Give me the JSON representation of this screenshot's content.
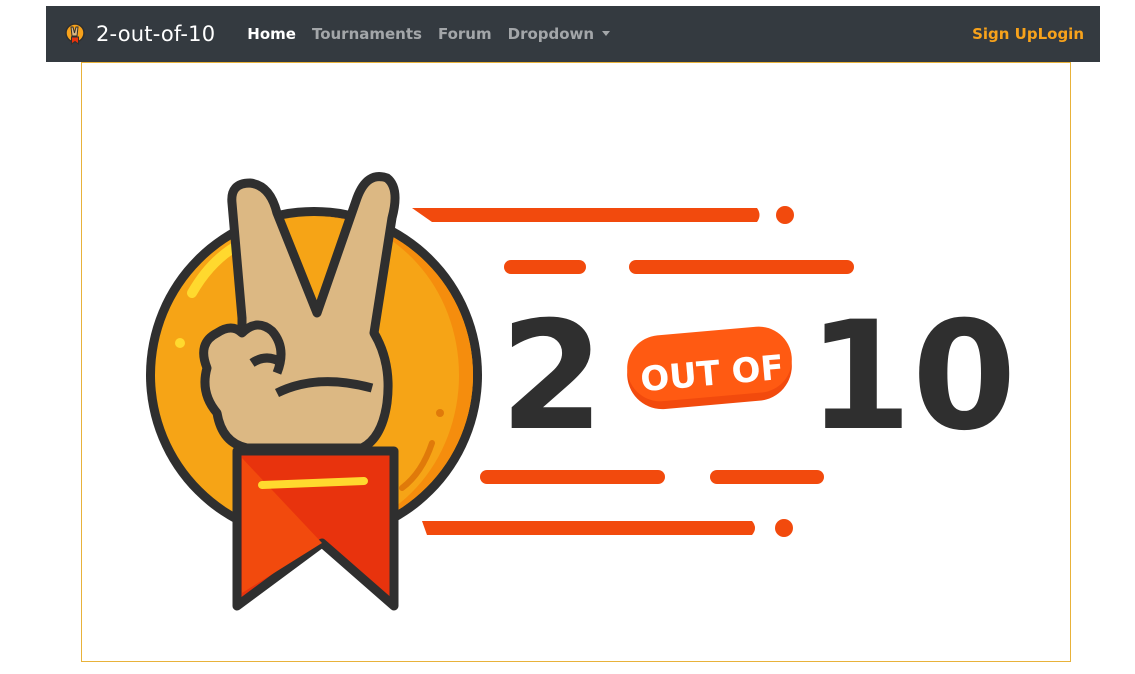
{
  "navbar": {
    "brand": "2-out-of-10",
    "links": [
      {
        "label": "Home",
        "active": true
      },
      {
        "label": "Tournaments",
        "active": false
      },
      {
        "label": "Forum",
        "active": false
      },
      {
        "label": "Dropdown",
        "active": false
      }
    ],
    "sign_up": "Sign Up",
    "login": "Login"
  },
  "hero": {
    "logo_number_left": "2",
    "logo_badge": "OUT OF",
    "logo_number_right": "10"
  },
  "colors": {
    "navbar_bg": "#343a40",
    "accent": "#f7a21b",
    "logo_orange": "#f24a0d",
    "logo_dark": "#2f2f2f"
  },
  "icons": [
    "brand-logo-icon",
    "dropdown-caret-icon"
  ]
}
